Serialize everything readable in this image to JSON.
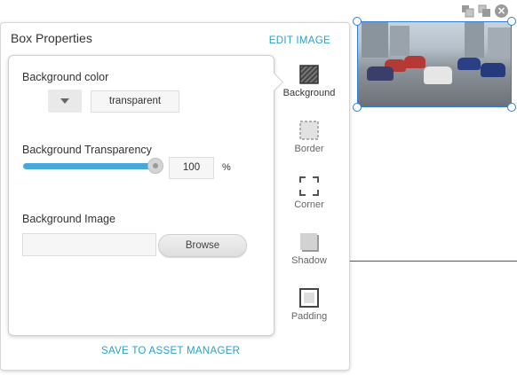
{
  "panel": {
    "title": "Box Properties",
    "edit_image": "EDIT IMAGE",
    "save_asset": "SAVE TO ASSET MANAGER"
  },
  "background": {
    "color_label": "Background color",
    "color_value": "transparent",
    "transparency_label": "Background Transparency",
    "transparency_value": "100",
    "transparency_unit": "%",
    "transparency_level": 1.0,
    "image_label": "Background Image",
    "image_value": "",
    "browse_label": "Browse"
  },
  "tools": [
    {
      "label": "Background",
      "icon": "hatched-square-icon",
      "active": true
    },
    {
      "label": "Border",
      "icon": "dashed-square-icon",
      "active": false
    },
    {
      "label": "Corner",
      "icon": "corner-brackets-icon",
      "active": false
    },
    {
      "label": "Shadow",
      "icon": "shadow-square-icon",
      "active": false
    },
    {
      "label": "Padding",
      "icon": "padding-square-icon",
      "active": false
    }
  ],
  "toolbar_icons": [
    "bring-forward-icon",
    "send-backward-icon",
    "close-icon"
  ],
  "colors": {
    "accent": "#2aa0c9",
    "slider": "#4aa8d6",
    "selection": "#2f7fd6"
  }
}
